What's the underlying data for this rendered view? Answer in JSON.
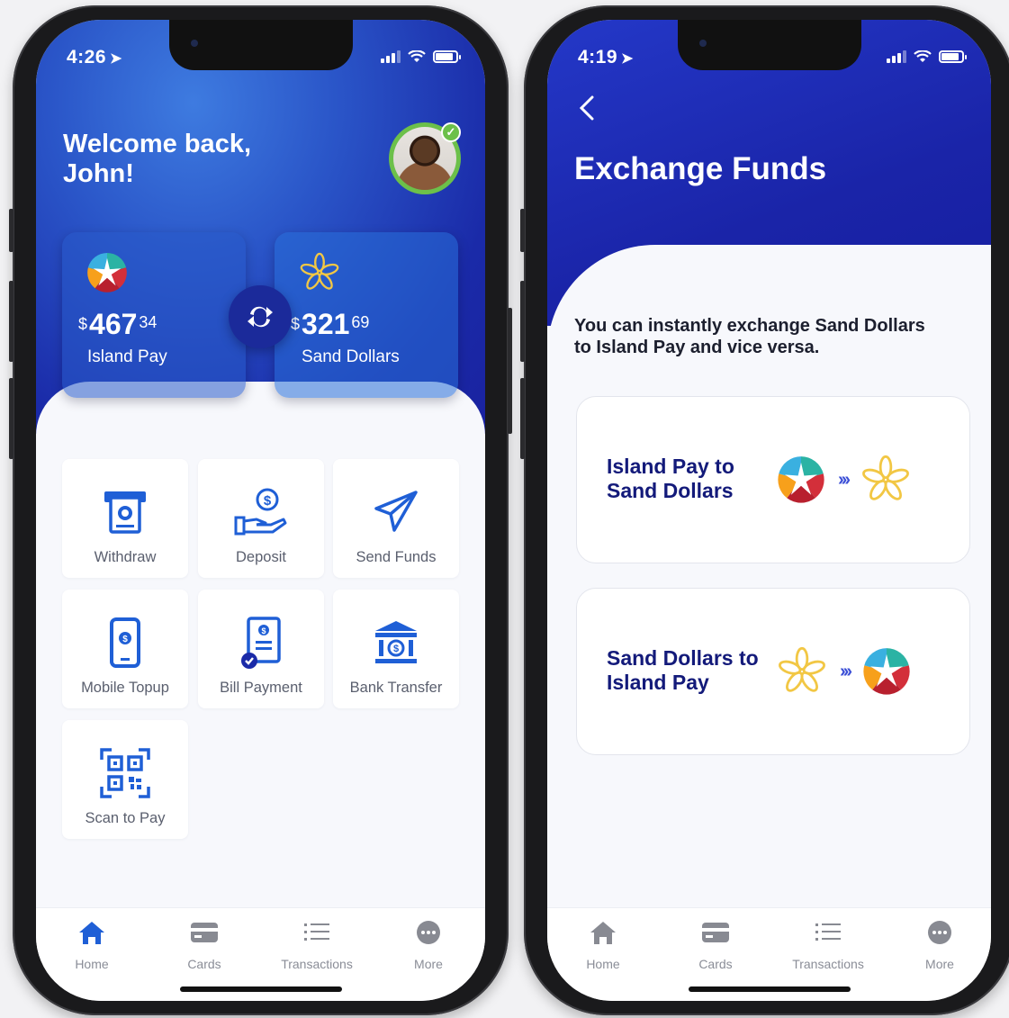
{
  "left_phone": {
    "status": {
      "time": "4:26"
    },
    "welcome": "Welcome back, John!",
    "balances": {
      "island_pay": {
        "currency": "$",
        "whole": "467",
        "cents": "34",
        "label": "Island Pay"
      },
      "sand_dollars": {
        "currency": "$",
        "whole": "321",
        "cents": "69",
        "label": "Sand Dollars"
      }
    },
    "actions": [
      {
        "label": "Withdraw",
        "icon": "atm-icon"
      },
      {
        "label": "Deposit",
        "icon": "deposit-hand-icon"
      },
      {
        "label": "Send Funds",
        "icon": "paper-plane-icon"
      },
      {
        "label": "Mobile Topup",
        "icon": "mobile-phone-icon"
      },
      {
        "label": "Bill Payment",
        "icon": "bill-icon"
      },
      {
        "label": "Bank Transfer",
        "icon": "bank-icon"
      },
      {
        "label": "Scan to Pay",
        "icon": "qr-code-icon"
      }
    ],
    "tabs": [
      {
        "label": "Home",
        "icon": "home-icon"
      },
      {
        "label": "Cards",
        "icon": "card-icon"
      },
      {
        "label": "Transactions",
        "icon": "list-icon"
      },
      {
        "label": "More",
        "icon": "more-icon"
      }
    ]
  },
  "right_phone": {
    "status": {
      "time": "4:19"
    },
    "title": "Exchange Funds",
    "description": "You can instantly exchange Sand Dollars to Island Pay and vice versa.",
    "options": [
      {
        "label": "Island Pay to Sand Dollars"
      },
      {
        "label": "Sand Dollars to Island Pay"
      }
    ],
    "tabs": [
      {
        "label": "Home",
        "icon": "home-icon"
      },
      {
        "label": "Cards",
        "icon": "card-icon"
      },
      {
        "label": "Transactions",
        "icon": "list-icon"
      },
      {
        "label": "More",
        "icon": "more-icon"
      }
    ]
  },
  "colors": {
    "primary_blue": "#1a24a8",
    "accent_blue": "#2a55c8",
    "tile_icon": "#1f5fd6",
    "option_text": "#131a7a",
    "avatar_ring": "#6cc04a",
    "sand_dollar_yellow": "#f2c744"
  }
}
